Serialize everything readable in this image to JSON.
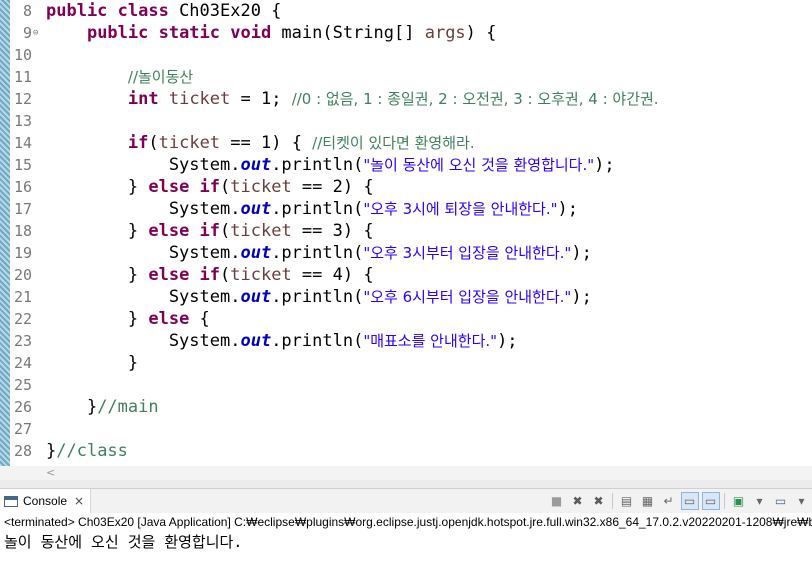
{
  "editor": {
    "lines": [
      {
        "n": "8",
        "tokens": [
          [
            "kw",
            "public class "
          ],
          [
            "",
            "Ch03Ex20 {"
          ]
        ]
      },
      {
        "n": "9",
        "fold": "true",
        "tokens": [
          [
            "",
            "    "
          ],
          [
            "kw",
            "public static void "
          ],
          [
            "",
            "main(String[] "
          ],
          [
            "va",
            "args"
          ],
          [
            "",
            ") {"
          ]
        ]
      },
      {
        "n": "10",
        "tokens": []
      },
      {
        "n": "11",
        "tokens": [
          [
            "",
            "        "
          ],
          [
            "cm",
            "//놀이동산"
          ]
        ]
      },
      {
        "n": "12",
        "tokens": [
          [
            "",
            "        "
          ],
          [
            "kw",
            "int "
          ],
          [
            "va",
            "ticket"
          ],
          [
            "",
            " = 1; "
          ],
          [
            "cm",
            "//0 : 없음, 1 : 종일권, 2 : 오전권, 3 : 오후권, 4 : 야간권."
          ]
        ]
      },
      {
        "n": "13",
        "tokens": []
      },
      {
        "n": "14",
        "tokens": [
          [
            "",
            "        "
          ],
          [
            "kw",
            "if"
          ],
          [
            "",
            "("
          ],
          [
            "va",
            "ticket"
          ],
          [
            "",
            " == 1) { "
          ],
          [
            "cm",
            "//티켓이 있다면 환영해라."
          ]
        ]
      },
      {
        "n": "15",
        "tokens": [
          [
            "",
            "            System."
          ],
          [
            "fi",
            "out"
          ],
          [
            "",
            ".println("
          ],
          [
            "st",
            "\"놀이 동산에 오신 것을 환영합니다.\""
          ],
          [
            "",
            ");"
          ]
        ]
      },
      {
        "n": "16",
        "tokens": [
          [
            "",
            "        } "
          ],
          [
            "kw",
            "else if"
          ],
          [
            "",
            "("
          ],
          [
            "va",
            "ticket"
          ],
          [
            "",
            " == 2) {"
          ]
        ]
      },
      {
        "n": "17",
        "tokens": [
          [
            "",
            "            System."
          ],
          [
            "fi",
            "out"
          ],
          [
            "",
            ".println("
          ],
          [
            "st",
            "\"오후 3시에 퇴장을 안내한다.\""
          ],
          [
            "",
            ");"
          ]
        ]
      },
      {
        "n": "18",
        "tokens": [
          [
            "",
            "        } "
          ],
          [
            "kw",
            "else if"
          ],
          [
            "",
            "("
          ],
          [
            "va",
            "ticket"
          ],
          [
            "",
            " == 3) {"
          ]
        ]
      },
      {
        "n": "19",
        "tokens": [
          [
            "",
            "            System."
          ],
          [
            "fi",
            "out"
          ],
          [
            "",
            ".println("
          ],
          [
            "st",
            "\"오후 3시부터 입장을 안내한다.\""
          ],
          [
            "",
            ");"
          ]
        ]
      },
      {
        "n": "20",
        "tokens": [
          [
            "",
            "        } "
          ],
          [
            "kw",
            "else if"
          ],
          [
            "",
            "("
          ],
          [
            "va",
            "ticket"
          ],
          [
            "",
            " == 4) {"
          ]
        ]
      },
      {
        "n": "21",
        "tokens": [
          [
            "",
            "            System."
          ],
          [
            "fi",
            "out"
          ],
          [
            "",
            ".println("
          ],
          [
            "st",
            "\"오후 6시부터 입장을 안내한다.\""
          ],
          [
            "",
            ");"
          ]
        ]
      },
      {
        "n": "22",
        "tokens": [
          [
            "",
            "        } "
          ],
          [
            "kw",
            "else"
          ],
          [
            "",
            " {"
          ]
        ]
      },
      {
        "n": "23",
        "tokens": [
          [
            "",
            "            System."
          ],
          [
            "fi",
            "out"
          ],
          [
            "",
            ".println("
          ],
          [
            "st",
            "\"매표소를 안내한다.\""
          ],
          [
            "",
            ");"
          ]
        ]
      },
      {
        "n": "24",
        "tokens": [
          [
            "",
            "        }"
          ]
        ]
      },
      {
        "n": "25",
        "tokens": []
      },
      {
        "n": "26",
        "tokens": [
          [
            "",
            "    }"
          ],
          [
            "cm",
            "//main"
          ]
        ]
      },
      {
        "n": "27",
        "tokens": []
      },
      {
        "n": "28",
        "tokens": [
          [
            "",
            "}"
          ],
          [
            "cm",
            "//class"
          ]
        ]
      }
    ],
    "fold_glyph": "⊖",
    "scroll_left_glyph": "<"
  },
  "console": {
    "tab_label": "Console",
    "close_glyph": "×",
    "toolbar": [
      {
        "name": "terminate-icon",
        "glyph": "■"
      },
      {
        "name": "remove-launch-icon",
        "glyph": "✖"
      },
      {
        "name": "remove-all-terminated-icon",
        "glyph": "✖"
      },
      {
        "sep": true
      },
      {
        "name": "clear-console-icon",
        "glyph": "▤"
      },
      {
        "name": "scroll-lock-icon",
        "glyph": "▦"
      },
      {
        "name": "word-wrap-icon",
        "glyph": "↵"
      },
      {
        "name": "show-on-stdout-icon",
        "glyph": "▭",
        "pressed": true
      },
      {
        "name": "show-on-stderr-icon",
        "glyph": "▭",
        "pressed": true
      },
      {
        "sep": true
      },
      {
        "name": "display-selected-console-icon",
        "glyph": "▣"
      },
      {
        "name": "open-console-dropdown-icon",
        "glyph": "▾"
      },
      {
        "name": "new-console-icon",
        "glyph": "▭"
      },
      {
        "name": "new-console-dropdown-icon",
        "glyph": "▾"
      }
    ],
    "status": "<terminated> Ch03Ex20 [Java Application] C:₩eclipse₩plugins₩org.eclipse.justj.openjdk.hotspot.jre.full.win32.x86_64_17.0.2.v20220201-1208₩jre₩bi",
    "output": "놀이 동산에 오신 것을 환영합니다."
  }
}
